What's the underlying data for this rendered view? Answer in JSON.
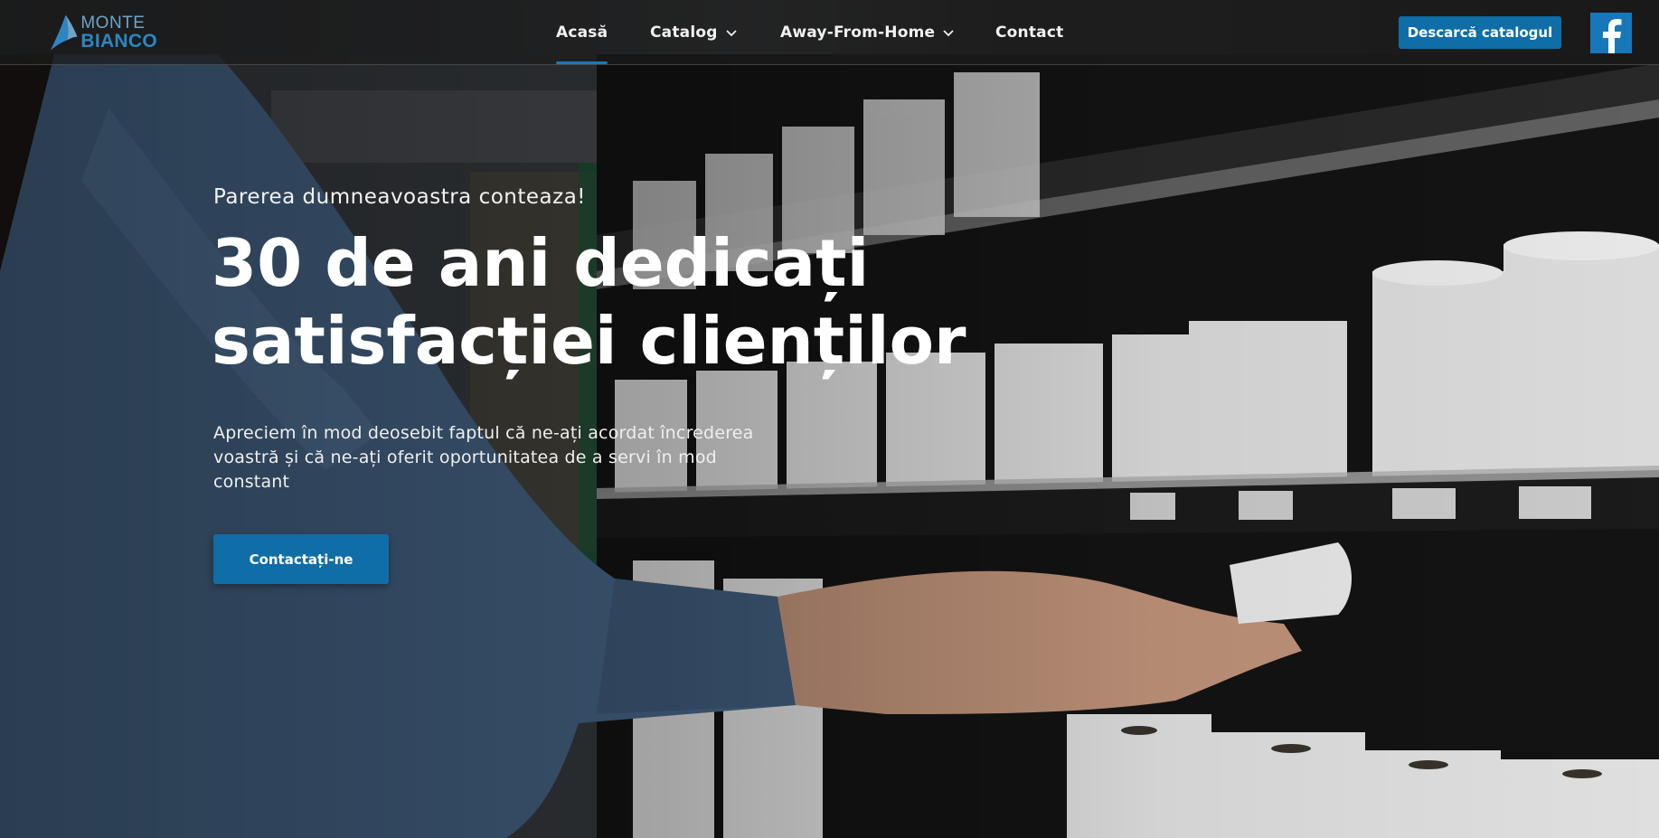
{
  "brand": {
    "logo_line1": "MONTE",
    "logo_line2": "BIANCO",
    "logo_icon": "mountain-sail-icon",
    "colors": {
      "primary": "#0f6ea7",
      "logo_light": "#6fa3c9",
      "logo_dark": "#2e86c1"
    }
  },
  "nav": {
    "items": [
      {
        "label": "Acasă",
        "active": true
      },
      {
        "label": "Catalog",
        "dropdown": true
      },
      {
        "label": "Away-From-Home",
        "dropdown": true
      },
      {
        "label": "Contact"
      }
    ],
    "download_button": "Descarcă catalogul",
    "social_icon": "facebook-icon"
  },
  "hero": {
    "kicker": "Parerea dumneavoastra conteaza!",
    "title_line1": "30 de ani dedicați",
    "title_line2": "satisfacției clienților",
    "lead": "Apreciem în mod deosebit faptul că ne-ați acordat încrederea voastră și că ne-ați oferit oportunitatea de a servi în mod constant",
    "cta_label": "Contactați-ne",
    "background_image": "woman-reaching-for-paper-towel-rolls-on-supermarket-shelf"
  }
}
